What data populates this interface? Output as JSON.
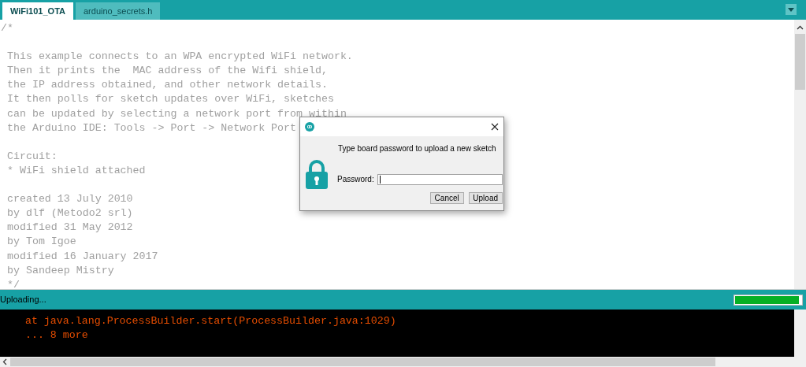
{
  "tabs": [
    {
      "label": "WiFi101_OTA",
      "selected": true
    },
    {
      "label": "arduino_secrets.h",
      "selected": false
    }
  ],
  "editor": {
    "blocks": [
      [
        "/*"
      ],
      [
        " This example connects to an WPA encrypted WiFi network.",
        " Then it prints the  MAC address of the Wifi shield,",
        " the IP address obtained, and other network details.",
        " It then polls for sketch updates over WiFi, sketches",
        " can be updated by selecting a network port from within",
        " the Arduino IDE: Tools -> Port -> Network Port"
      ],
      [
        " Circuit:",
        " * WiFi shield attached"
      ],
      [
        " created 13 July 2010",
        " by dlf (Metodo2 srl)",
        " modified 31 May 2012",
        " by Tom Igoe",
        " modified 16 January 2017",
        " by Sandeep Mistry",
        " */"
      ]
    ]
  },
  "dialog": {
    "message": "Type board password to upload a new sketch",
    "field_label": "Password:",
    "buttons": [
      "Cancel",
      "Upload"
    ]
  },
  "status_bar": {
    "text": "Uploading...",
    "progress": {
      "level": 0.97
    }
  },
  "console": {
    "lines": [
      "    at java.lang.ProcessBuilder.start(ProcessBuilder.java:1029)",
      "    ... 8 more"
    ]
  }
}
